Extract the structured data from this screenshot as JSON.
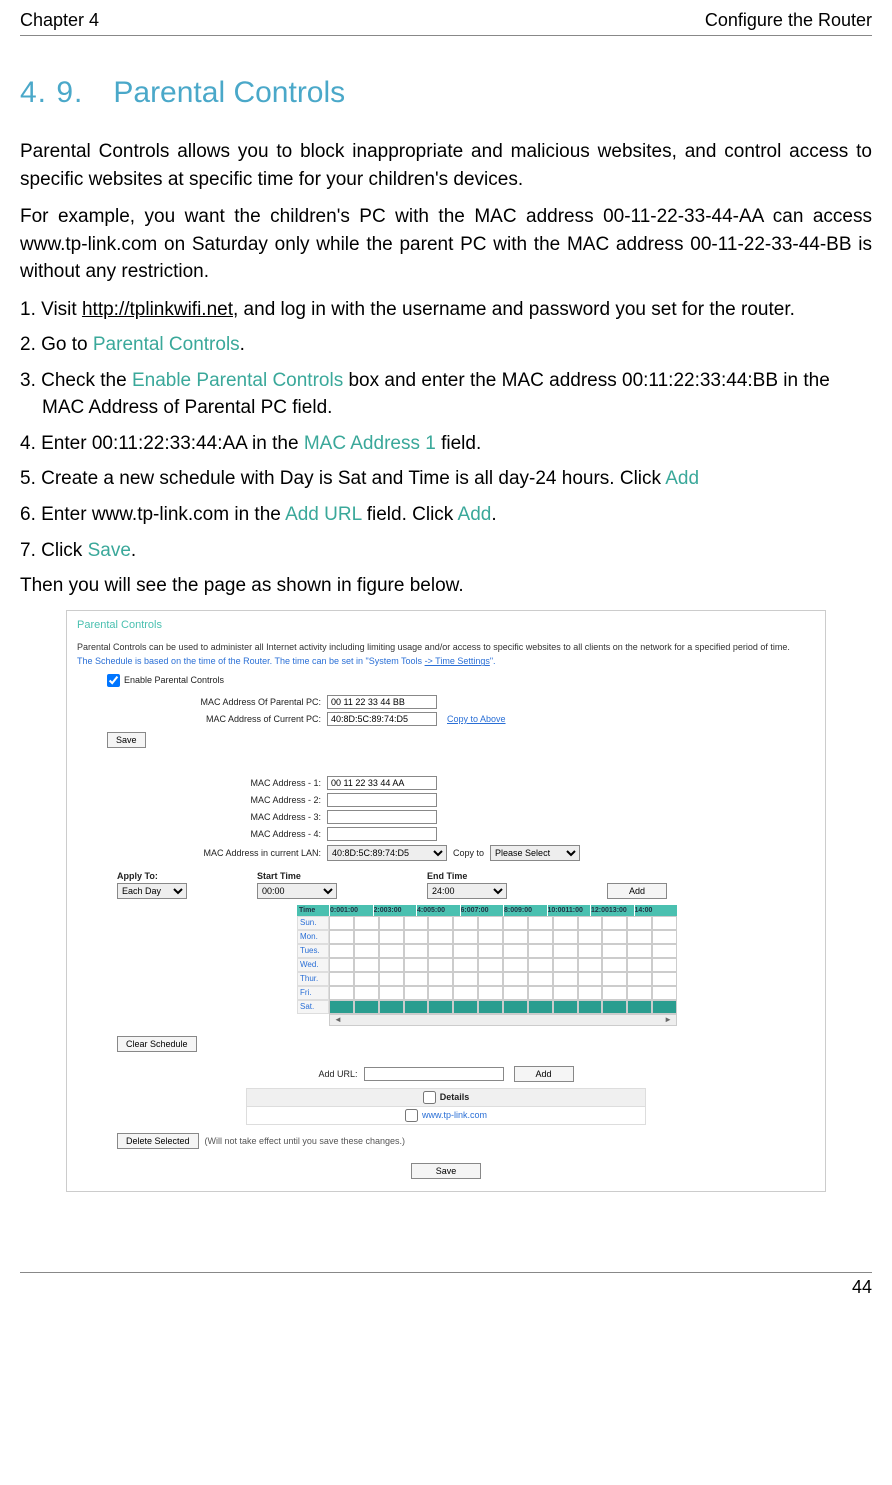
{
  "header": {
    "chapter": "Chapter 4",
    "title": "Configure the Router"
  },
  "section": {
    "number": "4. 9.",
    "title": "Parental Controls"
  },
  "para1": "Parental Controls allows you to block inappropriate and malicious websites, and control access to specific websites at specific time for your children's devices.",
  "para2": "For example, you want the children's PC with the MAC address 00-11-22-33-44-AA can access www.tp-link.com on Saturday only while the parent PC with the MAC address 00-11-22-33-44-BB is without any restriction.",
  "steps": {
    "s1a": "1. Visit ",
    "s1link": "http://tplinkwifi.net",
    "s1b": ", and log in with the username and password you set for the router.",
    "s2a": "2. Go to ",
    "s2t": "Parental Controls",
    "s2b": ".",
    "s3a": "3. Check the ",
    "s3t": "Enable Parental Controls",
    "s3b": " box and enter the MAC address 00:11:22:33:44:BB in the MAC Address of Parental PC field.",
    "s4a": "4. Enter 00:11:22:33:44:AA in the ",
    "s4t": "MAC Address 1",
    "s4b": " field.",
    "s5a": "5. Create a new schedule with Day is Sat and Time is all day-24 hours. Click ",
    "s5t": "Add",
    "s6a": "6. Enter www.tp-link.com in the ",
    "s6t1": "Add URL",
    "s6b": " field. Click ",
    "s6t2": "Add",
    "s6c": ".",
    "s7a": "7. Click ",
    "s7t": "Save",
    "s7b": "."
  },
  "para3": "Then you will see the page as shown in figure below.",
  "router": {
    "title": "Parental Controls",
    "desc1": "Parental Controls can be used to administer all Internet activity including limiting usage and/or access to specific websites to all clients on the network for a specified period of time.",
    "desc2a": "The Schedule is based on the time of the Router. The time can be set in \"System Tools ",
    "desc2link": "-> Time Settings",
    "desc2b": "\".",
    "enable": "Enable Parental Controls",
    "macParentalLabel": "MAC Address Of Parental PC:",
    "macParentalVal": "00 11 22 33 44 BB",
    "macCurrentLabel": "MAC Address of Current PC:",
    "macCurrentVal": "40:8D:5C:89:74:D5",
    "copyAbove": "Copy to Above",
    "save": "Save",
    "mac1Label": "MAC Address - 1:",
    "mac1Val": "00 11 22 33 44 AA",
    "mac2Label": "MAC Address - 2:",
    "mac3Label": "MAC Address - 3:",
    "mac4Label": "MAC Address - 4:",
    "macLanLabel": "MAC Address in current LAN:",
    "macLanVal": "40:8D:5C:89:74:D5",
    "copyTo": "Copy to",
    "pleaseSelect": "Please Select",
    "applyTo": "Apply To:",
    "eachDay": "Each Day",
    "startTime": "Start Time",
    "startVal": "00:00",
    "endTime": "End Time",
    "endVal": "24:00",
    "add": "Add",
    "timeHead": "Time",
    "hours": [
      "0:001:00",
      "2:003:00",
      "4:005:00",
      "6:007:00",
      "8:009:00",
      "10:0011:00",
      "12:0013:00",
      "14:00"
    ],
    "days": [
      "Sun.",
      "Mon.",
      "Tues.",
      "Wed.",
      "Thur.",
      "Fri.",
      "Sat."
    ],
    "clearSchedule": "Clear Schedule",
    "addUrlLabel": "Add URL:",
    "detailsHead": "Details",
    "detailsRow": "www.tp-link.com",
    "deleteSelected": "Delete Selected",
    "deleteNote": "(Will not take effect until you save these changes.)"
  },
  "footer": {
    "page": "44"
  }
}
